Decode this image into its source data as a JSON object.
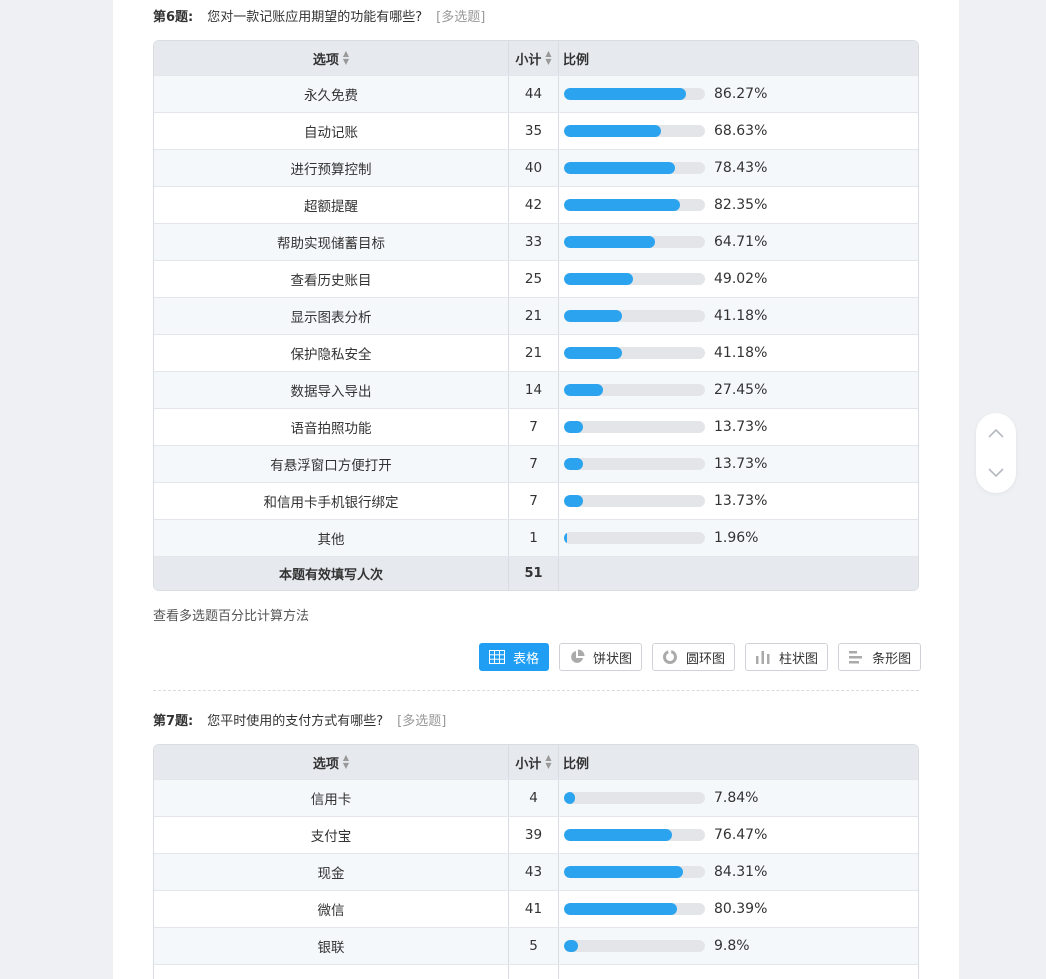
{
  "q6": {
    "number": "第6题:",
    "text": "您对一款记账应用期望的功能有哪些?",
    "type": "[多选题]",
    "headers": {
      "option": "选项",
      "count": "小计",
      "ratio": "比例"
    },
    "rows": [
      {
        "option": "永久免费",
        "count": "44",
        "pct": "86.27%",
        "value": 86.27
      },
      {
        "option": "自动记账",
        "count": "35",
        "pct": "68.63%",
        "value": 68.63
      },
      {
        "option": "进行预算控制",
        "count": "40",
        "pct": "78.43%",
        "value": 78.43
      },
      {
        "option": "超额提醒",
        "count": "42",
        "pct": "82.35%",
        "value": 82.35
      },
      {
        "option": "帮助实现储蓄目标",
        "count": "33",
        "pct": "64.71%",
        "value": 64.71
      },
      {
        "option": "查看历史账目",
        "count": "25",
        "pct": "49.02%",
        "value": 49.02
      },
      {
        "option": "显示图表分析",
        "count": "21",
        "pct": "41.18%",
        "value": 41.18
      },
      {
        "option": "保护隐私安全",
        "count": "21",
        "pct": "41.18%",
        "value": 41.18
      },
      {
        "option": "数据导入导出",
        "count": "14",
        "pct": "27.45%",
        "value": 27.45
      },
      {
        "option": "语音拍照功能",
        "count": "7",
        "pct": "13.73%",
        "value": 13.73
      },
      {
        "option": "有悬浮窗口方便打开",
        "count": "7",
        "pct": "13.73%",
        "value": 13.73
      },
      {
        "option": "和信用卡手机银行绑定",
        "count": "7",
        "pct": "13.73%",
        "value": 13.73
      },
      {
        "option": "其他",
        "count": "1",
        "pct": "1.96%",
        "value": 1.96
      }
    ],
    "footer": {
      "label": "本题有效填写人次",
      "count": "51"
    },
    "calc_link": "查看多选题百分比计算方法",
    "view_buttons": [
      "表格",
      "饼状图",
      "圆环图",
      "柱状图",
      "条形图"
    ]
  },
  "q7": {
    "number": "第7题:",
    "text": "您平时使用的支付方式有哪些?",
    "type": "[多选题]",
    "headers": {
      "option": "选项",
      "count": "小计",
      "ratio": "比例"
    },
    "rows": [
      {
        "option": "信用卡",
        "count": "4",
        "pct": "7.84%",
        "value": 7.84
      },
      {
        "option": "支付宝",
        "count": "39",
        "pct": "76.47%",
        "value": 76.47
      },
      {
        "option": "现金",
        "count": "43",
        "pct": "84.31%",
        "value": 84.31
      },
      {
        "option": "微信",
        "count": "41",
        "pct": "80.39%",
        "value": 80.39
      },
      {
        "option": "银联",
        "count": "5",
        "pct": "9.8%",
        "value": 9.8
      }
    ]
  },
  "icons": {
    "sort": "sort-icon",
    "table": "table-icon",
    "pie": "pie-chart-icon",
    "ring": "ring-chart-icon",
    "column": "column-chart-icon",
    "bar": "bar-chart-icon",
    "up": "chevron-up-icon",
    "down": "chevron-down-icon"
  },
  "colors": {
    "accent": "#1f9ef3",
    "bar_fill": "#2ba3ef",
    "bar_track": "#e3e5e8"
  }
}
